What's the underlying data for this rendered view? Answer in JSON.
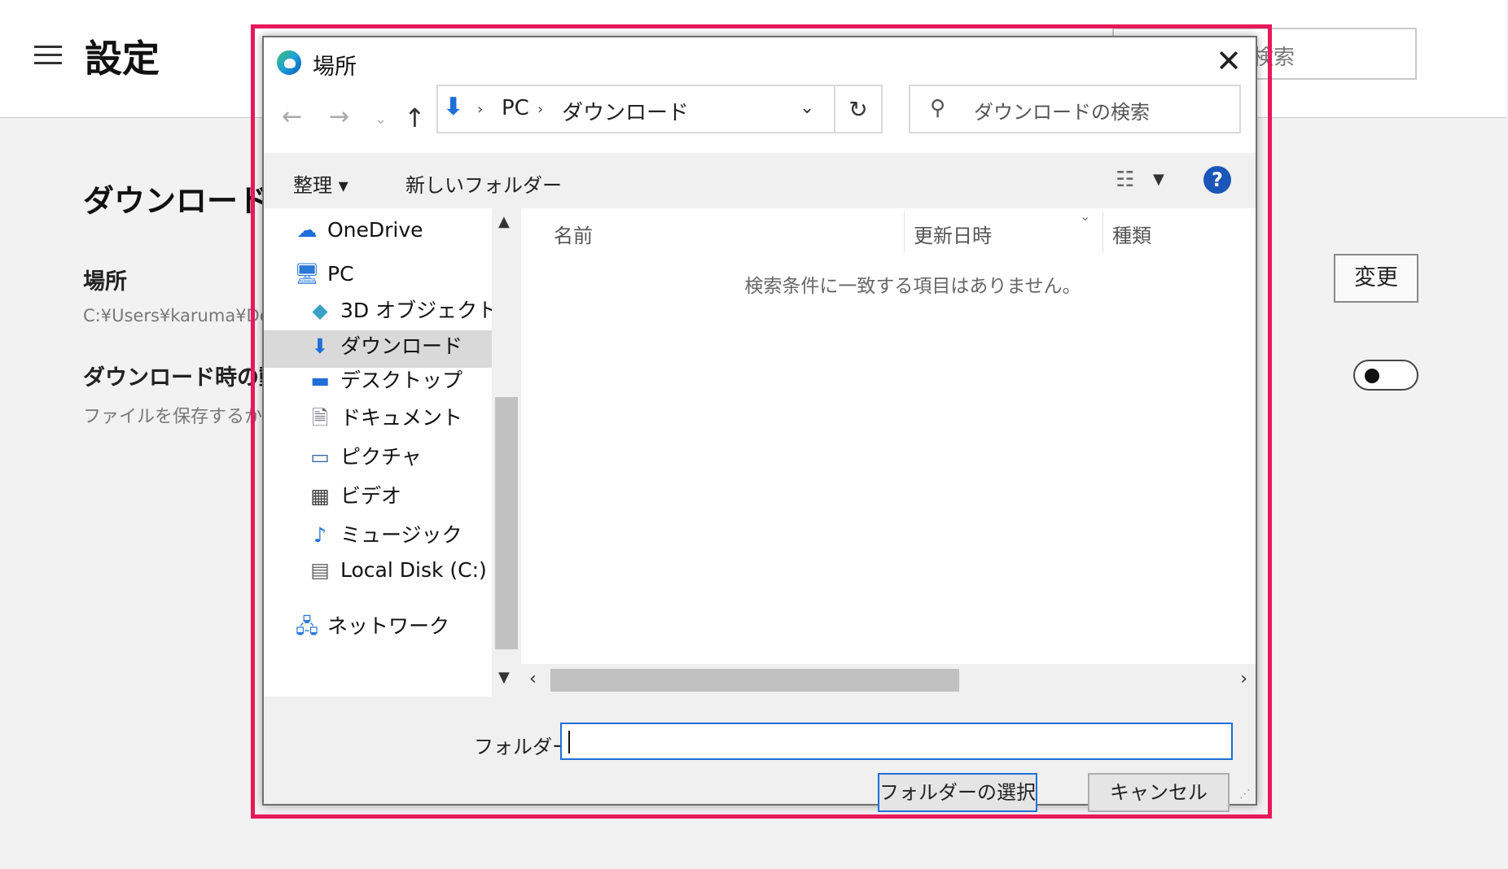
{
  "settings": {
    "title": "設定",
    "search_placeholder": "検索",
    "section_title": "ダウンロード",
    "location_label": "場所",
    "location_path": "C:¥Users¥karuma¥Do",
    "ask_label": "ダウンロード時の動作",
    "ask_desc": "ファイルを保存するか、保",
    "change_button": "変更",
    "toggle_on": false
  },
  "dialog": {
    "title": "場所",
    "close_glyph": "✕",
    "address": {
      "segments": [
        "PC",
        "ダウンロード"
      ]
    },
    "search_placeholder": "ダウンロードの検索",
    "toolbar": {
      "organize": "整理 ▾",
      "new_folder": "新しいフォルダー"
    },
    "nav_items": [
      {
        "label": "OneDrive",
        "icon": "onedrive-icon"
      },
      {
        "label": "PC",
        "icon": "pc-icon"
      },
      {
        "label": "3D オブジェクト",
        "icon": "3d-objects-icon"
      },
      {
        "label": "ダウンロード",
        "icon": "download-icon",
        "selected": true
      },
      {
        "label": "デスクトップ",
        "icon": "desktop-icon"
      },
      {
        "label": "ドキュメント",
        "icon": "documents-icon"
      },
      {
        "label": "ピクチャ",
        "icon": "pictures-icon"
      },
      {
        "label": "ビデオ",
        "icon": "videos-icon"
      },
      {
        "label": "ミュージック",
        "icon": "music-icon"
      },
      {
        "label": "Local Disk (C:)",
        "icon": "local-disk-icon"
      },
      {
        "label": "ネットワーク",
        "icon": "network-icon"
      }
    ],
    "columns": [
      "名前",
      "更新日時",
      "種類"
    ],
    "empty_message": "検索条件に一致する項目はありません。",
    "folder_label": "フォルダー:",
    "folder_value": "",
    "select_button": "フォルダーの選択",
    "cancel_button": "キャンセル"
  },
  "colors": {
    "highlight": "#e8185a",
    "accent": "#1f6fd8"
  }
}
